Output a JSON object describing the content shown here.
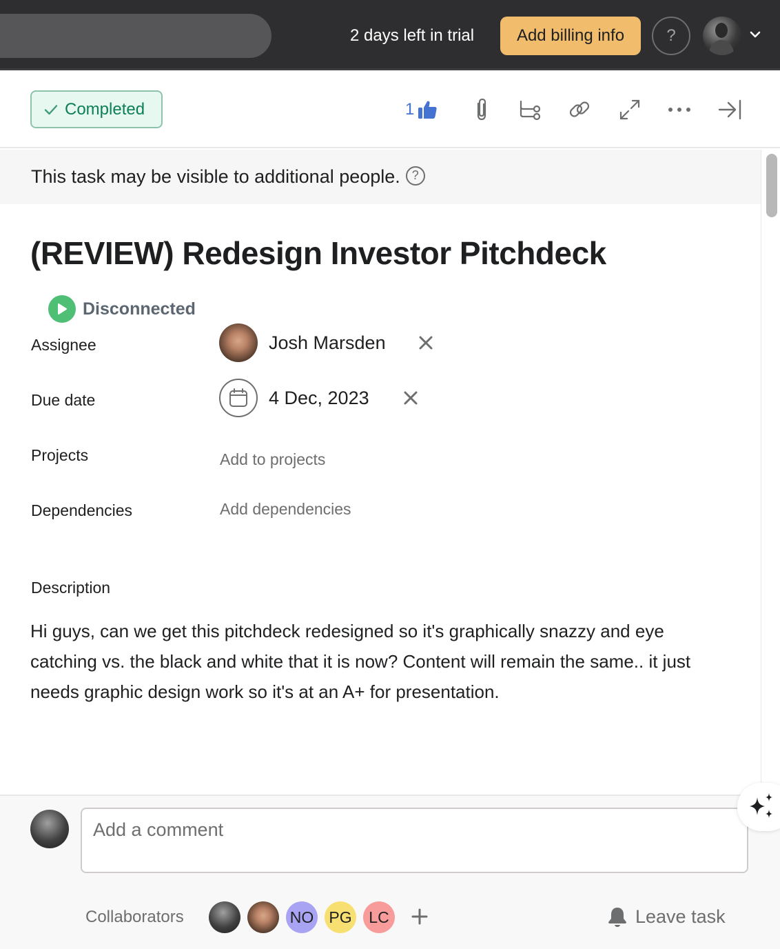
{
  "topbar": {
    "trial_text": "2 days left in trial",
    "billing_button": "Add billing info",
    "help_label": "?"
  },
  "task": {
    "status_button": "Completed",
    "like_count": "1",
    "visibility_notice": "This task may be visible to additional people.",
    "visibility_help": "?",
    "title": "(REVIEW) Redesign Investor Pitchdeck",
    "integration_status": "Disconnected",
    "fields": {
      "assignee_label": "Assignee",
      "assignee_name": "Josh Marsden",
      "due_date_label": "Due date",
      "due_date_value": "4 Dec, 2023",
      "projects_label": "Projects",
      "projects_action": "Add to projects",
      "dependencies_label": "Dependencies",
      "dependencies_action": "Add dependencies"
    },
    "description_label": "Description",
    "description": "Hi guys, can we get this pitchdeck redesigned so it's graphically snazzy and eye catching vs. the black and white that it is now? Content will remain the same.. it just needs graphic design work so it's at an A+ for presentation."
  },
  "footer": {
    "comment_placeholder": "Add a comment",
    "collaborators_label": "Collaborators",
    "collaborators": [
      {
        "type": "photo",
        "initials": ""
      },
      {
        "type": "photo",
        "initials": ""
      },
      {
        "type": "initials",
        "initials": "NO",
        "color": "#a8a3f2"
      },
      {
        "type": "initials",
        "initials": "PG",
        "color": "#f8df72"
      },
      {
        "type": "initials",
        "initials": "LC",
        "color": "#f89b9b"
      }
    ],
    "leave_task": "Leave task"
  },
  "colors": {
    "topbar_bg": "#2e2e30",
    "billing_accent": "#f1bd6c",
    "completed_green": "#0d7f56",
    "like_blue": "#4573d2",
    "integration_green": "#4fbf76"
  }
}
